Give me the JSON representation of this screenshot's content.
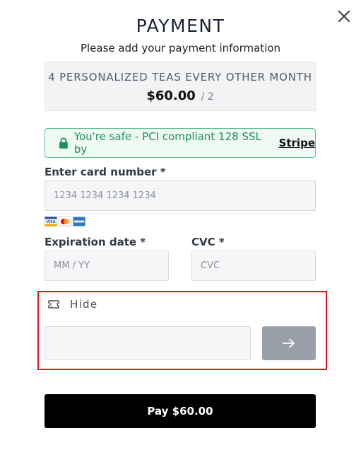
{
  "header": {
    "title": "PAYMENT",
    "subtitle": "Please add your payment information",
    "close_icon": "close-icon"
  },
  "plan": {
    "name": "4 PERSONALIZED TEAS EVERY OTHER MONTH",
    "price": "$60.00",
    "period": "/ 2"
  },
  "security": {
    "icon": "lock-icon",
    "text": "You're safe - PCI compliant 128 SSL by",
    "provider": "Stripe"
  },
  "form": {
    "card_number_label": "Enter card number *",
    "card_number_placeholder": "1234 1234 1234 1234",
    "card_brands": [
      "Visa",
      "Mastercard",
      "American Express"
    ],
    "expiration_label": "Expiration date *",
    "expiration_placeholder": "MM / YY",
    "cvc_label": "CVC *",
    "cvc_placeholder": "CVC"
  },
  "promo": {
    "toggle_label": "Hide",
    "icon": "ticket-icon",
    "input_value": "",
    "submit_icon": "arrow-right-icon"
  },
  "pay_button": {
    "label": "Pay $60.00"
  },
  "colors": {
    "highlight_border": "#e3151b",
    "safe_green": "#1f8f5c",
    "pay_button_bg": "#000000",
    "promo_submit_bg": "#9aa0aa"
  }
}
